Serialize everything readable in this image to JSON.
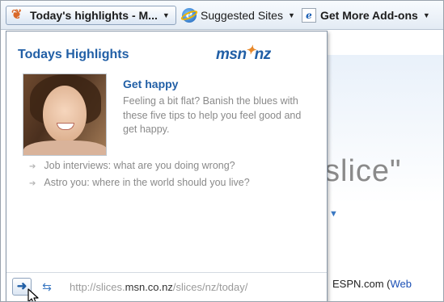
{
  "favorites_bar": {
    "slice_label": "Today's highlights - M...",
    "suggested_label": "Suggested Sites",
    "addons_label": "Get More Add-ons",
    "dropdown_glyph": "▼"
  },
  "icons": {
    "slice": "webslice-icon",
    "suggested": "ie-icon",
    "addons": "addons-page-icon",
    "go": "go-arrow-icon",
    "refresh": "refresh-icon",
    "bullet": "bullet-arrow-icon"
  },
  "flyout": {
    "title": "Todays Highlights",
    "logo_msn": "msn",
    "logo_nz": "nz",
    "story_headline": "Get happy",
    "story_text": "Feeling a bit flat? Banish the blues with these five tips to help you feel good and get happy.",
    "more_links": [
      "Job interviews: what are you doing wrong?",
      "Astro you: where in the world should you live?"
    ],
    "url_prefix": "http://slices.",
    "url_host": "msn.co.nz",
    "url_path": "/slices/nz/today/"
  },
  "background_page": {
    "heading_fragment": "slice\"",
    "footer_text": "ESPN.com (",
    "footer_link": "Web"
  },
  "colors": {
    "accent": "#215fa6",
    "muted_text": "#8a8a8a",
    "logo_orange": "#e8892b"
  }
}
